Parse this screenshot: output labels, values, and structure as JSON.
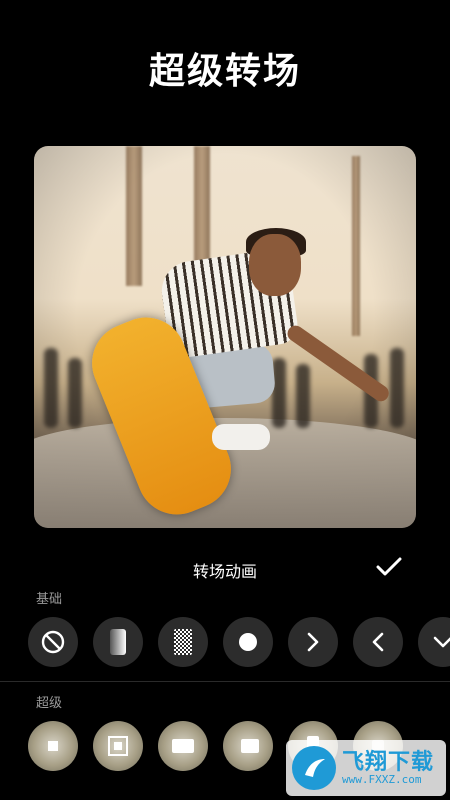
{
  "header": {
    "title": "超级转场"
  },
  "panel": {
    "title": "转场动画"
  },
  "basic": {
    "label": "基础",
    "items": [
      {
        "icon": "none-icon"
      },
      {
        "icon": "gradient-icon"
      },
      {
        "icon": "dissolve-icon"
      },
      {
        "icon": "circle-icon"
      },
      {
        "icon": "arrow-right-icon"
      },
      {
        "icon": "arrow-left-icon"
      },
      {
        "icon": "arrow-down-icon"
      }
    ]
  },
  "super": {
    "label": "超级",
    "items": [
      {
        "icon": "zoom-square-icon"
      },
      {
        "icon": "frame-square-icon"
      },
      {
        "icon": "rect-icon"
      },
      {
        "icon": "rect-right-icon"
      },
      {
        "icon": "rect-tall-icon"
      },
      {
        "icon": "rect-blur-icon"
      }
    ]
  },
  "watermark": {
    "name": "飞翔下载",
    "url": "www.FXXZ.com"
  },
  "colors": {
    "background": "#000000",
    "button": "#2c2c2c",
    "label": "#9a9a9a",
    "watermark": "#1f9ad6"
  }
}
